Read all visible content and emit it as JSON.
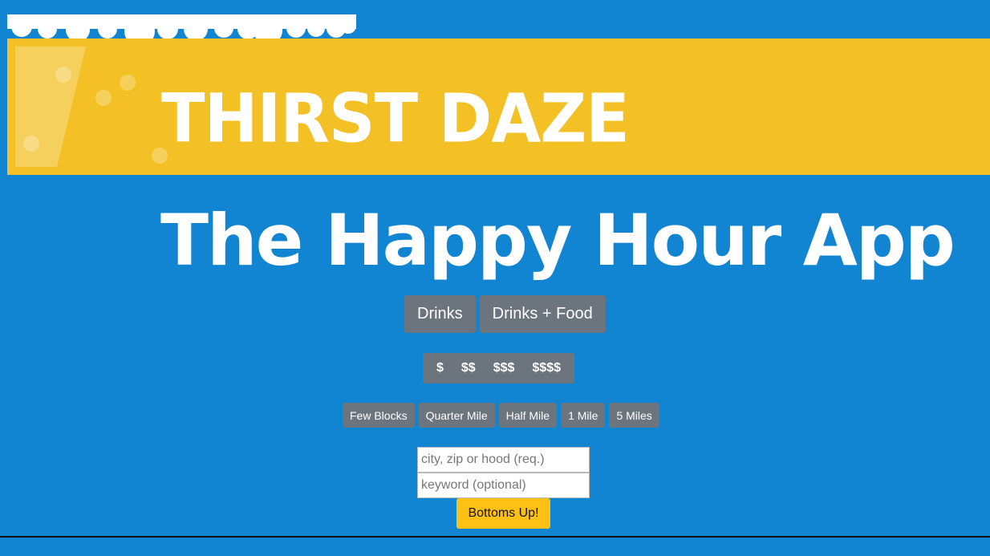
{
  "header": {
    "brand": "THIRST DAZE",
    "subtitle": "The Happy Hour App"
  },
  "type_filters": [
    "Drinks",
    "Drinks + Food"
  ],
  "price_filters": [
    "$",
    "$$",
    "$$$",
    "$$$$"
  ],
  "distance_filters": [
    "Few Blocks",
    "Quarter Mile",
    "Half Mile",
    "1 Mile",
    "5 Miles"
  ],
  "search": {
    "location_placeholder": "city, zip or hood (req.)",
    "keyword_placeholder": "keyword (optional)",
    "submit_label": "Bottoms Up!"
  },
  "colors": {
    "background": "#1185d1",
    "banner": "#f3c026",
    "button": "#6c757d",
    "submit": "#fcc114"
  },
  "icons": {
    "foam": "beer-foam-icon",
    "glass": "beer-glass-icon"
  }
}
